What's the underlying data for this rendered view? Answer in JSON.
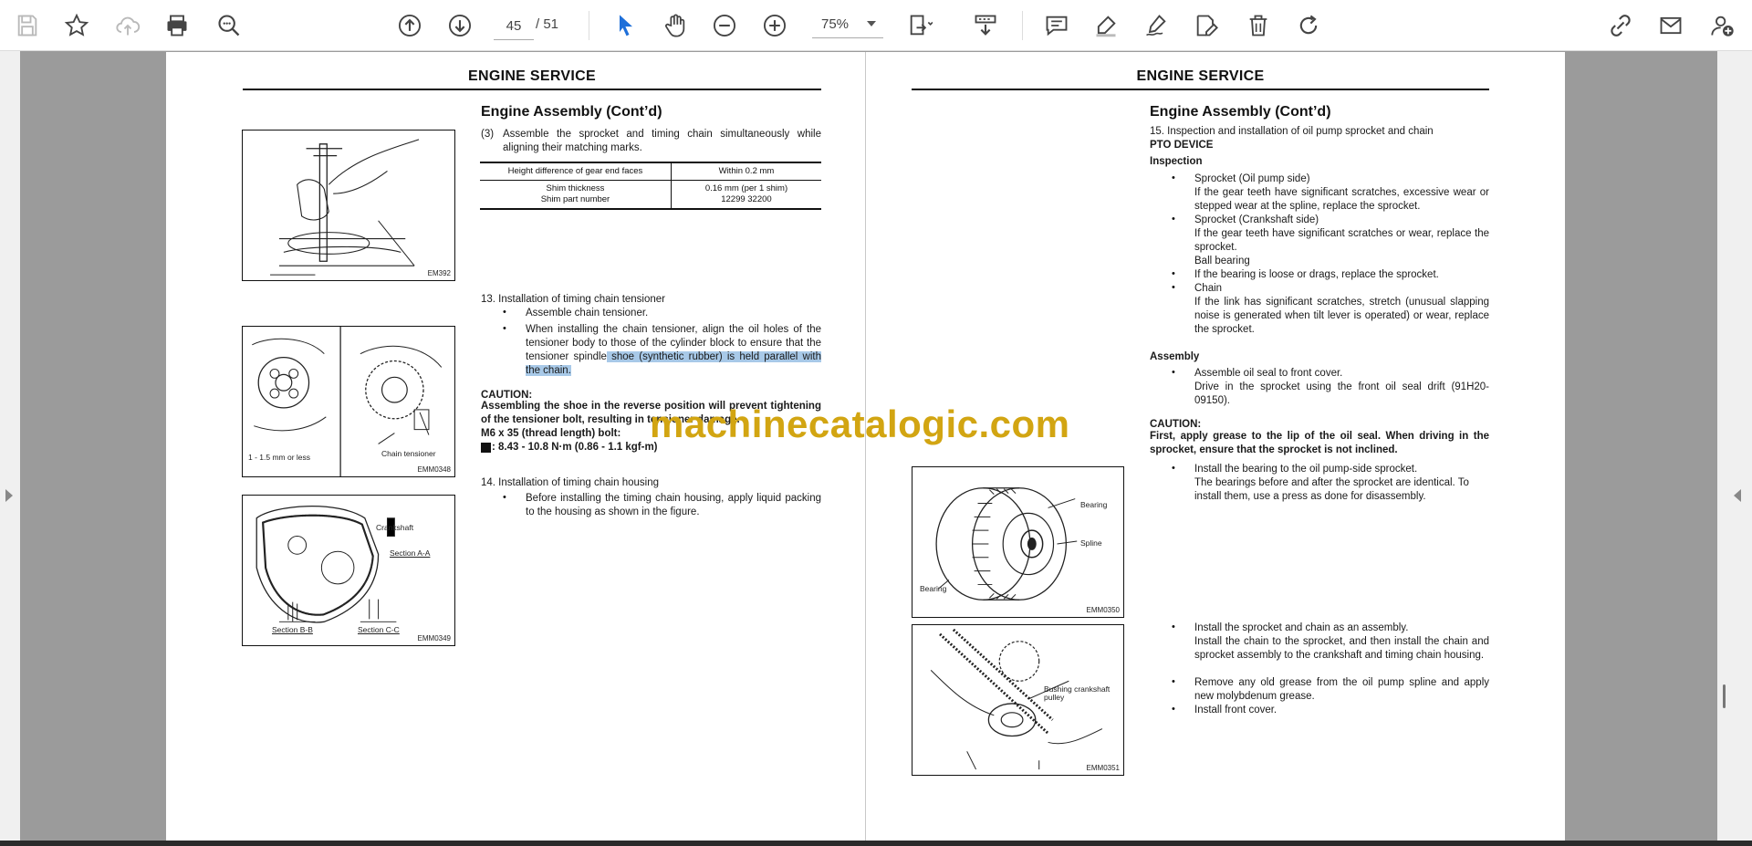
{
  "toolbar": {
    "page_current": "45",
    "page_total": "/  51",
    "zoom": "75%"
  },
  "left_page": {
    "header": "ENGINE SERVICE",
    "title": "Engine Assembly (Cont’d)",
    "step3_num": "(3)",
    "step3_text": "Assemble the sprocket and timing chain simultaneously while aligning their matching marks.",
    "table": {
      "r1_label": "Height difference of gear end faces",
      "r1_value": "Within 0.2 mm",
      "r2_label_a": "Shim thickness",
      "r2_label_b": "Shim part number",
      "r2_value_a": "0.16 mm (per 1 shim)",
      "r2_value_b": "12299 32200"
    },
    "step13_title": "13.  Installation of timing chain tensioner",
    "step13_b1": "Assemble chain tensioner.",
    "step13_b2_a": "When installing the chain tensioner, align the oil holes of the tensioner body to those of the cylinder block to ensure that the tensioner spindle",
    "step13_b2_hl": " shoe (synthetic rubber) is held parallel with the chain.",
    "caution_label": "CAUTION:",
    "caution_text": "Assembling the shoe in the reverse position will prevent tightening of the tensioner bolt, resulting in tensioner damage.",
    "bolt_text": "M6 x 35 (thread length) bolt:",
    "torque_text": ": 8.43 - 10.8 N·m (0.86 - 1.1 kgf-m)",
    "step14_title": "14.  Installation of timing chain housing",
    "step14_b1": "Before installing the timing chain housing, apply liquid packing to the housing as shown in the figure.",
    "fig1_code": "EM392",
    "fig2_code": "EMM0348",
    "fig2_label_a": "1 - 1.5 mm or less",
    "fig2_label_b": "Chain tensioner",
    "fig3_code": "EMM0349",
    "fig3_label_a": "Section A-A",
    "fig3_label_b": "Section B-B",
    "fig3_label_c": "Section C-C",
    "fig3_label_d": "Crankshaft"
  },
  "right_page": {
    "header": "ENGINE SERVICE",
    "title": "Engine Assembly (Cont’d)",
    "step15": "15.  Inspection and installation of oil pump sprocket and chain",
    "pto": "PTO DEVICE",
    "inspection": "Inspection",
    "b1_title": "Sprocket (Oil pump side)",
    "b1_text": "If the gear teeth have significant scratches, excessive wear or stepped wear at the spline, replace the sprocket.",
    "b2_title": "Sprocket (Crankshaft side)",
    "b2_text": "If the gear teeth have significant scratches or wear, replace the sprocket.",
    "b2_sub": "Ball bearing",
    "b3_text": "If the bearing is loose or drags, replace the sprocket.",
    "b4_title": "Chain",
    "b4_text": "If the link has significant scratches, stretch (unusual slapping noise is generated when tilt lever is operated) or wear, replace the sprocket.",
    "assembly": "Assembly",
    "a1_title": "Assemble oil seal to front cover.",
    "a1_text": "Drive in the sprocket using the front oil seal drift (91H20-09150).",
    "caution_label": "CAUTION:",
    "caution_text": "First, apply grease to the lip of the oil seal. When driving in the sprocket, ensure that the sprocket is not inclined.",
    "a2_title": "Install the bearing to the oil pump-side sprocket.",
    "a2_text": "The bearings before and after the sprocket are identical. To install them, use a press as done for disassembly.",
    "a3_title": "Install the sprocket and chain as an assembly.",
    "a3_text": "Install the chain to the sprocket, and then install the chain and sprocket assembly to the crankshaft and timing chain housing.",
    "a4_text": "Remove any old grease from the oil pump spline and apply new molybdenum grease.",
    "a5_text": "Install front cover.",
    "fig4_code": "EMM0350",
    "fig4_label_a": "Bearing",
    "fig4_label_b": "Spline",
    "fig4_label_c": "Bearing",
    "fig5_code": "EMM0351",
    "fig5_label_a": "Bushing crankshaft pulley"
  },
  "watermark": "machinecatalogic.com"
}
